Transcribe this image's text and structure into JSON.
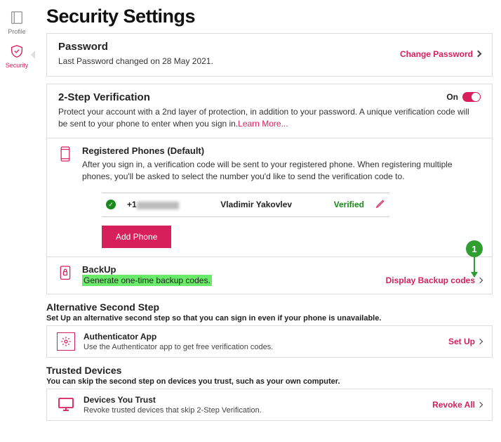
{
  "sidebar": {
    "items": [
      {
        "label": "Profile"
      },
      {
        "label": "Security"
      }
    ]
  },
  "page": {
    "title": "Security Settings"
  },
  "password": {
    "title": "Password",
    "status": "Last Password changed on 28 May 2021.",
    "action": "Change Password"
  },
  "twostep": {
    "title": "2-Step Verification",
    "state_label": "On",
    "desc": "Protect your account with a 2nd layer of protection, in addition to your password. A unique verification code will be sent to your phone to enter when you sign in.",
    "learn": "Learn More..."
  },
  "phones": {
    "title": "Registered Phones (Default)",
    "desc": "After you sign in, a verification code will be sent to your registered phone. When registering multiple phones, you'll be asked to select the number you'd like to send the verification code to.",
    "row": {
      "prefix": "+1",
      "name": "Vladimir Yakovlev",
      "status": "Verified"
    },
    "add_btn": "Add Phone"
  },
  "backup": {
    "title": "BackUp",
    "highlight": "Generate one-time backup codes.",
    "action": "Display Backup codes"
  },
  "alt": {
    "heading": "Alternative Second Step",
    "sub": "Set Up an alternative second step so that you can sign in even if your phone is unavailable.",
    "app_title": "Authenticator App",
    "app_sub": "Use the Authenticator app to get free verification codes.",
    "action": "Set Up"
  },
  "trusted": {
    "heading": "Trusted Devices",
    "sub": "You can skip the second step on devices you trust, such as your own computer.",
    "title": "Devices You Trust",
    "desc": "Revoke trusted devices that skip 2-Step Verification.",
    "action": "Revoke All"
  },
  "callout": {
    "num": "1"
  }
}
